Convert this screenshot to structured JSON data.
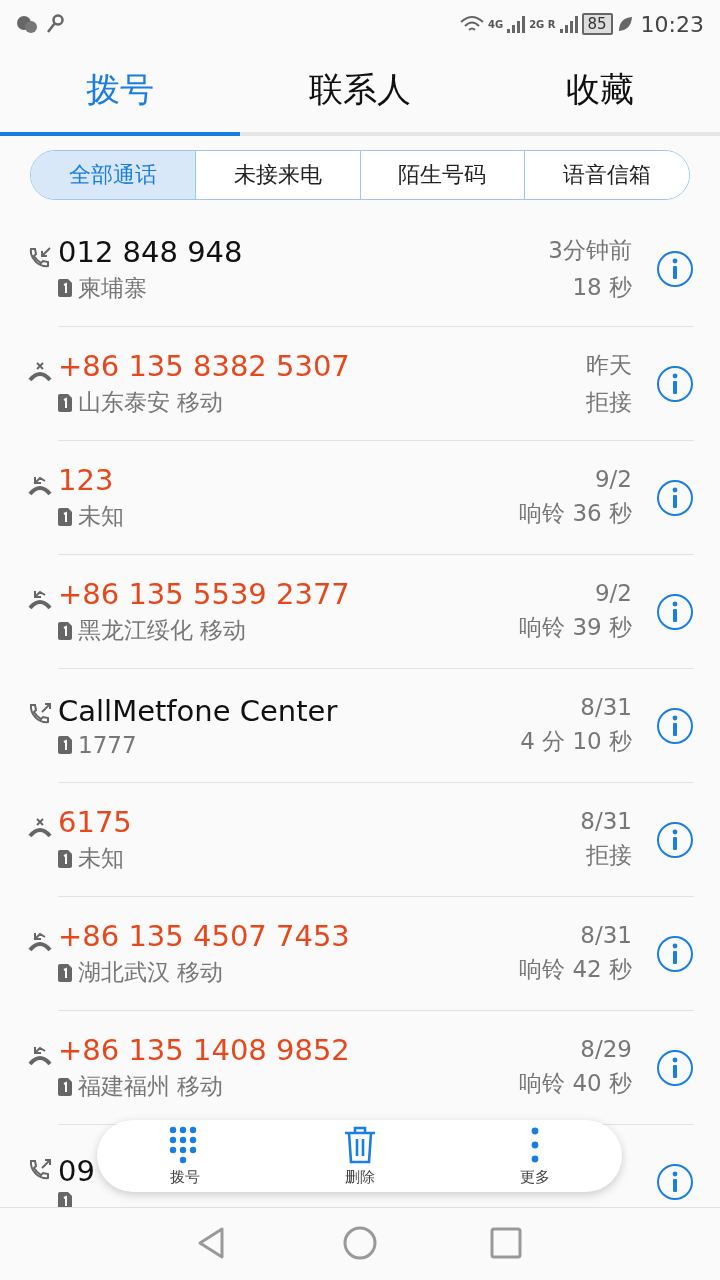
{
  "status_bar": {
    "network_1": "4G",
    "network_2": "2G R",
    "battery": "85",
    "time": "10:23"
  },
  "tabs": [
    {
      "label": "拨号",
      "selected": true
    },
    {
      "label": "联系人",
      "selected": false
    },
    {
      "label": "收藏",
      "selected": false
    }
  ],
  "filters": [
    {
      "label": "全部通话",
      "selected": true
    },
    {
      "label": "未接来电",
      "selected": false
    },
    {
      "label": "陌生号码",
      "selected": false
    },
    {
      "label": "语音信箱",
      "selected": false
    }
  ],
  "calls": [
    {
      "kind": "incoming",
      "name": "012 848 948",
      "location": "柬埔寨",
      "time": "3分钟前",
      "detail": "18 秒"
    },
    {
      "kind": "rejected",
      "name": "+86 135 8382 5307",
      "location": "山东泰安 移动",
      "time": "昨天",
      "detail": "拒接"
    },
    {
      "kind": "missed",
      "name": "123",
      "location": "未知",
      "time": "9/2",
      "detail": "响铃 36 秒"
    },
    {
      "kind": "missed",
      "name": "+86 135 5539 2377",
      "location": "黑龙江绥化 移动",
      "time": "9/2",
      "detail": "响铃 39 秒"
    },
    {
      "kind": "outgoing",
      "name": "CallMetfone Center",
      "location": "1777",
      "time": "8/31",
      "detail": "4 分 10 秒"
    },
    {
      "kind": "rejected",
      "name": "6175",
      "location": "未知",
      "time": "8/31",
      "detail": "拒接"
    },
    {
      "kind": "missed",
      "name": "+86 135 4507 7453",
      "location": "湖北武汉 移动",
      "time": "8/31",
      "detail": "响铃 42 秒"
    },
    {
      "kind": "missed",
      "name": "+86 135 1408 9852",
      "location": "福建福州 移动",
      "time": "8/29",
      "detail": "响铃 40 秒"
    },
    {
      "kind": "outgoing",
      "name": "09"
    }
  ],
  "actions": [
    {
      "kind": "dialpad",
      "label": "拨号"
    },
    {
      "kind": "delete",
      "label": "删除"
    },
    {
      "kind": "more",
      "label": "更多"
    }
  ]
}
